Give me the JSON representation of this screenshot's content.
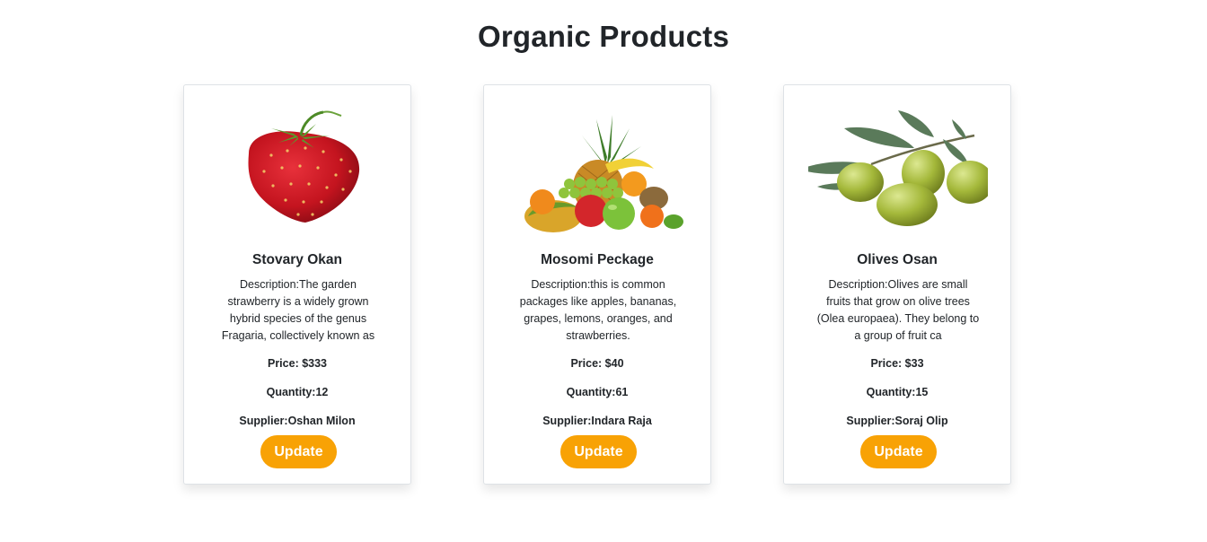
{
  "page": {
    "title": "Organic Products"
  },
  "products": [
    {
      "name": "Stovary Okan",
      "image_icon": "strawberry-image",
      "description": "Description:The garden strawberry is a widely grown hybrid species of the genus Fragaria, collectively known as",
      "price": "Price: $333",
      "quantity": "Quantity:12",
      "supplier": "Supplier:Oshan Milon",
      "button_label": "Update"
    },
    {
      "name": "Mosomi Peckage",
      "image_icon": "fruit-assortment-image",
      "description": "Description:this is common packages like apples, bananas, grapes, lemons, oranges, and strawberries.",
      "price": "Price: $40",
      "quantity": "Quantity:61",
      "supplier": "Supplier:Indara Raja",
      "button_label": "Update"
    },
    {
      "name": "Olives Osan",
      "image_icon": "olives-image",
      "description": "Description:Olives are small fruits that grow on olive trees (Olea europaea). They belong to a group of fruit ca",
      "price": "Price: $33",
      "quantity": "Quantity:15",
      "supplier": "Supplier:Soraj Olip",
      "button_label": "Update"
    }
  ],
  "colors": {
    "button": "#f8a205",
    "button_text": "#ffffff",
    "text": "#212529"
  }
}
